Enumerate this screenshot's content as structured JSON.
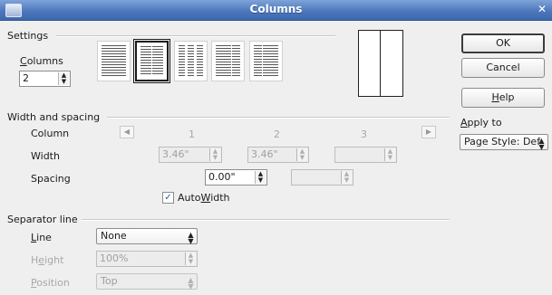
{
  "window": {
    "title": "Columns"
  },
  "settings": {
    "section": "Settings",
    "columns_label": "Columns",
    "columns_value": "2"
  },
  "buttons": {
    "ok": "OK",
    "cancel": "Cancel",
    "help": "Help"
  },
  "apply_to": {
    "label": "Apply to",
    "value": "Page Style: Def"
  },
  "width_spacing": {
    "section": "Width and spacing",
    "column_label": "Column",
    "width_label": "Width",
    "spacing_label": "Spacing",
    "col_numbers": [
      "1",
      "2",
      "3"
    ],
    "widths": [
      "3.46\"",
      "3.46\"",
      ""
    ],
    "spacing": [
      "0.00\"",
      ""
    ],
    "autowidth_label": "AutoWidth",
    "autowidth_checked": true
  },
  "separator": {
    "section": "Separator line",
    "line_label": "Line",
    "line_value": "None",
    "height_label": "Height",
    "height_value": "100%",
    "position_label": "Position",
    "position_value": "Top"
  },
  "icons": {
    "app": "window-app-icon",
    "close": "close-icon",
    "prev": "arrow-left-icon",
    "next": "arrow-right-icon",
    "check": "checkmark-icon"
  }
}
